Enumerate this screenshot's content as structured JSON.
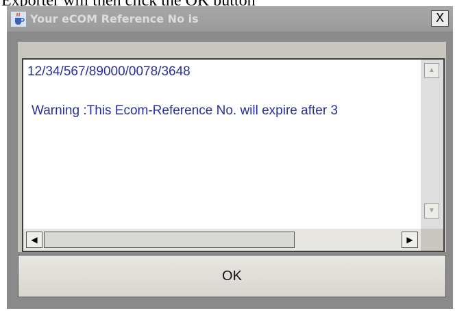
{
  "doc_caption": "Exporter will then click the OK button",
  "dialog": {
    "title": "Your eCOM Reference No is",
    "title_icon": "java-cup-icon",
    "close_label": "X",
    "ok_label": "OK"
  },
  "textarea": {
    "reference_no": "12/34/567/89000/0078/3648",
    "warning": "Warning :This Ecom-Reference No. will expire after 3"
  },
  "scrollbar": {
    "up_icon": "▲",
    "down_icon": "▼",
    "left_icon": "◀",
    "right_icon": "▶"
  }
}
